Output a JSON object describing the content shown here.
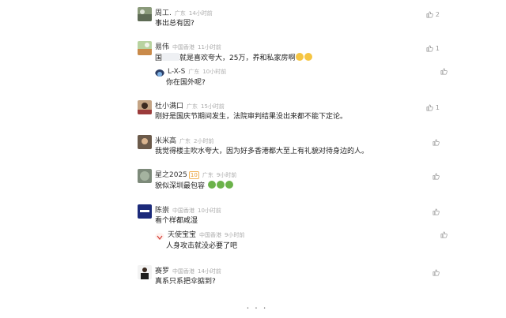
{
  "colors": {
    "meta": "#aaaaaa",
    "like": "#999999",
    "text": "#222222"
  },
  "comments": [
    {
      "name": "周工.",
      "location": "广东",
      "time": "14小时前",
      "text": "事出总有因?",
      "likes": "2"
    },
    {
      "name": "易伟",
      "location": "中国香港",
      "time": "11小时前",
      "text_before": "国",
      "text_after": "就是喜欢夸大，25万，养和私家房啊",
      "likes": "1",
      "reply": {
        "name": "L-X-S",
        "location": "广东",
        "time": "10小时前",
        "text": "你在国外呢?"
      }
    },
    {
      "name": "杜小满口",
      "location": "广东",
      "time": "15小时前",
      "text": "刚好是国庆节期间发生，法院审判结果没出来都不能下定论。",
      "likes": "1"
    },
    {
      "name": "米米高",
      "location": "广东",
      "time": "2小时前",
      "text": "我觉得楼主吹水夸大，因为好多香港都大至上有礼貌对待身边的人。"
    },
    {
      "name": "星之2025",
      "badge": "10",
      "location": "广东",
      "time": "9小时前",
      "text": "貌似深圳最包容"
    },
    {
      "name": "陈崇",
      "location": "中国香港",
      "time": "10小时前",
      "text": "看个样都咸湿",
      "reply": {
        "name": "天使宝宝",
        "location": "中国香港",
        "time": "9小时前",
        "text": "人身攻击就没必要了吧"
      }
    },
    {
      "name": "赛罗",
      "location": "中国香港",
      "time": "14小时前",
      "text": "真系只系把伞掂到?"
    }
  ],
  "footer": {
    "dots": "• • •"
  }
}
